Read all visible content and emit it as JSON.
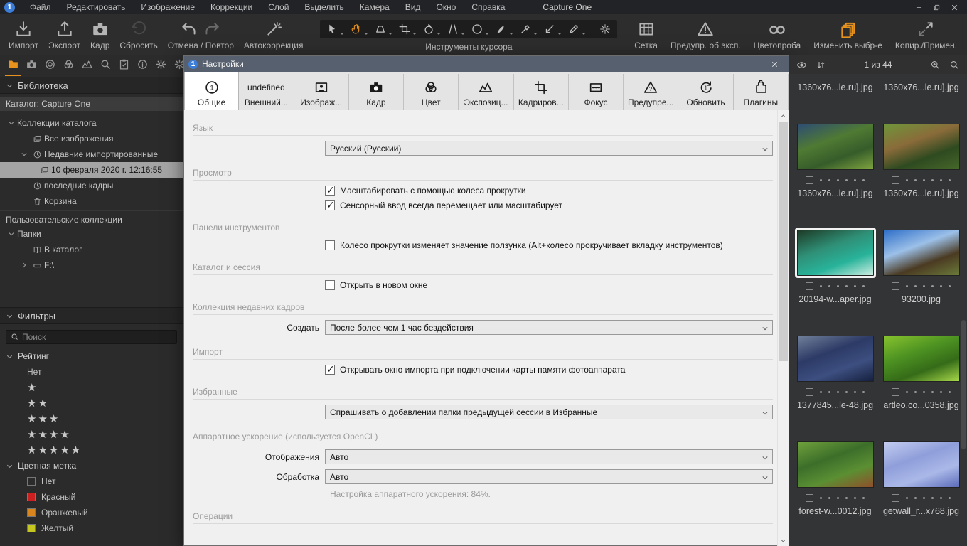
{
  "app": {
    "title": "Capture One"
  },
  "menu": {
    "items": [
      "Файл",
      "Редактировать",
      "Изображение",
      "Коррекции",
      "Слой",
      "Выделить",
      "Камера",
      "Вид",
      "Окно",
      "Справка"
    ]
  },
  "window_controls": [
    {
      "icon": "minimize"
    },
    {
      "icon": "restore"
    },
    {
      "icon": "close"
    }
  ],
  "toolbar": {
    "left_buttons": [
      {
        "icon": "import",
        "label": "Импорт"
      },
      {
        "icon": "export",
        "label": "Экспорт"
      },
      {
        "icon": "camera",
        "label": "Кадр"
      },
      {
        "icon": "reset",
        "label": "Сбросить",
        "dim": true
      },
      {
        "icon": "undo-redo",
        "label": "Отмена / Повтор"
      },
      {
        "icon": "wand",
        "label": "Автокоррекция"
      }
    ],
    "cursor_tools": {
      "label": "Инструменты курсора",
      "tools": [
        {
          "icon": "cursor"
        },
        {
          "icon": "hand",
          "active": true
        },
        {
          "icon": "keystone"
        },
        {
          "icon": "crop"
        },
        {
          "icon": "rotate"
        },
        {
          "icon": "straighten"
        },
        {
          "icon": "circle"
        },
        {
          "icon": "brush"
        },
        {
          "icon": "dropper"
        },
        {
          "icon": "pick-arrow"
        },
        {
          "icon": "pencil"
        }
      ],
      "extra_tool": {
        "icon": "spark"
      }
    },
    "right_buttons": [
      {
        "icon": "grid",
        "label": "Сетка"
      },
      {
        "icon": "warning",
        "label": "Предупр. об эксп."
      },
      {
        "icon": "glasses",
        "label": "Цветопроба"
      },
      {
        "icon": "copies",
        "label": "Изменить выбр-е",
        "accent": true
      },
      {
        "icon": "copy-apply",
        "label": "Копир./Примен."
      }
    ]
  },
  "sidebar": {
    "tool_tabs": [
      {
        "icon": "folder",
        "active": true
      },
      {
        "icon": "camera"
      },
      {
        "icon": "lens"
      },
      {
        "icon": "color-wheels"
      },
      {
        "icon": "exposure"
      },
      {
        "icon": "magnifier"
      },
      {
        "icon": "metadata"
      },
      {
        "icon": "info"
      },
      {
        "icon": "gear"
      },
      {
        "icon": "gear"
      }
    ],
    "library": {
      "header": "Библиотека",
      "catalog_bar": "Каталог: Capture One",
      "tree": [
        {
          "label": "Коллекции каталога",
          "level": 0,
          "chevron": "down"
        },
        {
          "label": "Все изображения",
          "level": 1,
          "icon": "images"
        },
        {
          "label": "Недавние импортированные",
          "level": 1,
          "icon": "clock",
          "chevron": "down"
        },
        {
          "label": "10 февраля 2020 г. 12:16:55",
          "level": 2,
          "icon": "images",
          "selected": true
        },
        {
          "label": "последние кадры",
          "level": 1,
          "icon": "clock"
        },
        {
          "label": "Корзина",
          "level": 1,
          "icon": "trash"
        },
        {
          "label": "Пользовательские коллекции",
          "level": 0,
          "group": true
        },
        {
          "label": "Папки",
          "level": 0,
          "chevron": "down"
        },
        {
          "label": "В каталог",
          "level": 1,
          "icon": "book"
        },
        {
          "label": "F:\\",
          "level": 1,
          "icon": "drive",
          "chevron": "right"
        }
      ]
    },
    "filters": {
      "header": "Фильтры",
      "search_placeholder": "Поиск",
      "rating": {
        "header": "Рейтинг",
        "items": [
          {
            "label": "Нет",
            "stars": 0
          },
          {
            "stars": 1
          },
          {
            "stars": 2
          },
          {
            "stars": 3
          },
          {
            "stars": 4
          },
          {
            "stars": 5
          }
        ]
      },
      "color_labels": {
        "header": "Цветная метка",
        "items": [
          {
            "label": "Нет",
            "color": ""
          },
          {
            "label": "Красный",
            "color": "#cc1f1f"
          },
          {
            "label": "Оранжевый",
            "color": "#d9851e"
          },
          {
            "label": "Желтый",
            "color": "#c6c620"
          }
        ]
      }
    }
  },
  "dialog": {
    "title": "Настройки",
    "tabs": [
      {
        "label": "Общие",
        "icon": "circled-1",
        "active": true
      },
      {
        "label": "Внешний...",
        "icon": "eye"
      },
      {
        "label": "Изображ...",
        "icon": "picture"
      },
      {
        "label": "Кадр",
        "icon": "camera-filled"
      },
      {
        "label": "Цвет",
        "icon": "color-wheels"
      },
      {
        "label": "Экспозиц...",
        "icon": "exposure"
      },
      {
        "label": "Кадриров...",
        "icon": "crop"
      },
      {
        "label": "Фокус",
        "icon": "focus"
      },
      {
        "label": "Предупре...",
        "icon": "warning-q"
      },
      {
        "label": "Обновить",
        "icon": "refresh-1"
      },
      {
        "label": "Плагины",
        "icon": "puzzle"
      }
    ],
    "sections": [
      {
        "header": "Язык",
        "rows": [
          {
            "type": "select",
            "label": "",
            "value": "Русский (Русский)"
          }
        ]
      },
      {
        "header": "Просмотр",
        "rows": [
          {
            "type": "checkbox",
            "checked": true,
            "label": "Масштабировать с помощью колеса прокрутки"
          },
          {
            "type": "checkbox",
            "checked": true,
            "label": "Сенсорный ввод всегда перемещает или масштабирует"
          }
        ]
      },
      {
        "header": "Панели инструментов",
        "rows": [
          {
            "type": "checkbox",
            "checked": false,
            "label": "Колесо прокрутки изменяет значение ползунка (Alt+колесо прокручивает вкладку инструментов)"
          }
        ]
      },
      {
        "header": "Каталог и сессия",
        "rows": [
          {
            "type": "checkbox",
            "checked": false,
            "label": "Открыть в новом окне"
          }
        ]
      },
      {
        "header": "Коллекция недавних кадров",
        "rows": [
          {
            "type": "select",
            "label": "Создать",
            "value": "После более чем 1 час бездействия"
          }
        ]
      },
      {
        "header": "Импорт",
        "rows": [
          {
            "type": "checkbox",
            "checked": true,
            "label": "Открывать окно импорта при подключении карты памяти фотоаппарата"
          }
        ]
      },
      {
        "header": "Избранные",
        "rows": [
          {
            "type": "select",
            "label": "",
            "value": "Спрашивать о добавлении папки предыдущей сессии в Избранные"
          }
        ]
      },
      {
        "header": "Аппаратное ускорение (используется OpenCL)",
        "rows": [
          {
            "type": "select",
            "label": "Отображения",
            "value": "Авто"
          },
          {
            "type": "select",
            "label": "Обработка",
            "value": "Авто"
          },
          {
            "type": "note",
            "label": "Настройка аппаратного ускорения: 84%."
          }
        ]
      },
      {
        "header": "Операции",
        "rows": []
      }
    ]
  },
  "browser": {
    "count": "1 из 44",
    "partial_row": [
      "1360x76...le.ru].jpg",
      "1360x76...le.ru].jpg"
    ],
    "rows": [
      [
        {
          "file": "1360x76...le.ru].jpg",
          "palette": [
            "#2e4d72",
            "#4f7a33",
            "#7fa43f",
            "#365c2a"
          ]
        },
        {
          "file": "1360x76...le.ru].jpg",
          "palette": [
            "#6f953a",
            "#8a6b3a",
            "#46682a",
            "#2e4a20"
          ]
        }
      ],
      [
        {
          "file": "20194-w...aper.jpg",
          "selected": true,
          "palette": [
            "#1d3a26",
            "#2f8f76",
            "#cdeee2",
            "#28b39a"
          ]
        },
        {
          "file": "93200.jpg",
          "palette": [
            "#2f6fc9",
            "#9cc0e8",
            "#6b7a3a",
            "#4a3a22"
          ]
        }
      ],
      [
        {
          "file": "1377845...le-48.jpg",
          "palette": [
            "#707f99",
            "#2c3a66",
            "#16203f",
            "#3d4f80"
          ]
        },
        {
          "file": "artleo.co...0358.jpg",
          "palette": [
            "#86c22e",
            "#4d9222",
            "#a8d84a",
            "#356b18"
          ]
        }
      ],
      [
        {
          "file": "forest-w...0012.jpg",
          "palette": [
            "#6fa03c",
            "#3c6e2a",
            "#8f4f2a",
            "#5b8f33"
          ]
        },
        {
          "file": "getwall_r...x768.jpg",
          "palette": [
            "#c3cdf0",
            "#8f9eda",
            "#5c6cba",
            "#aab8e8"
          ]
        }
      ]
    ]
  },
  "colors": {
    "accent": "#e8921e",
    "dialog_titlebar": "#57606e",
    "selection": "#a4a4a4"
  }
}
